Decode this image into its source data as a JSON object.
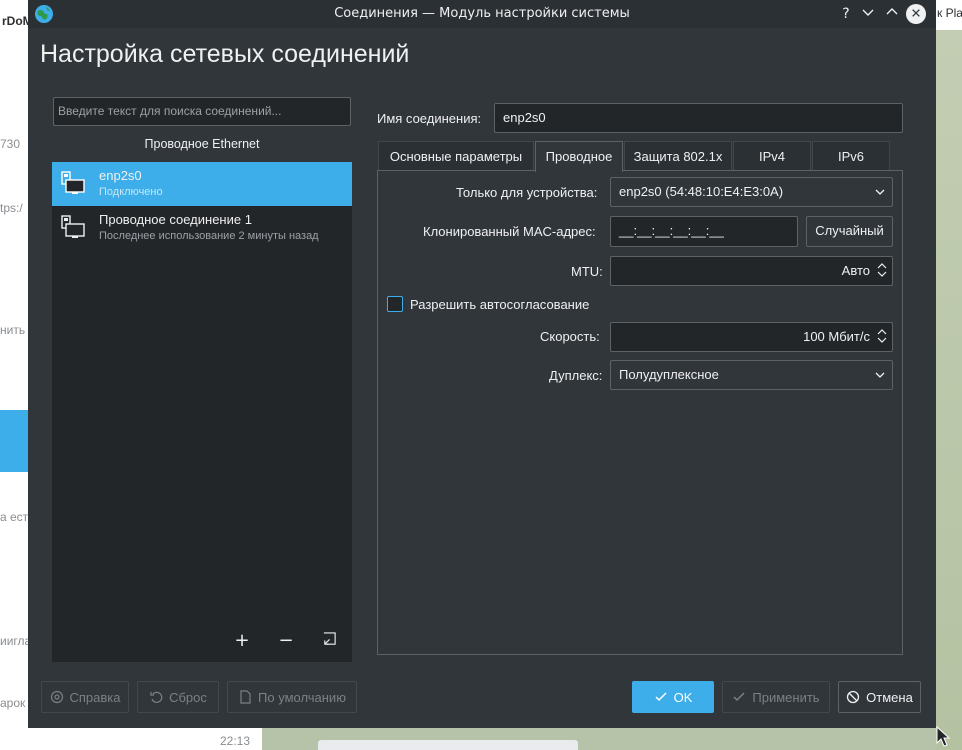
{
  "background": {
    "texts": [
      "rDoM",
      "730",
      "tps:/",
      "нить",
      "а ест",
      "ииглас",
      "арок",
      "22:13",
      "к Pla"
    ]
  },
  "window": {
    "title": "Соединения — Модуль настройки системы",
    "heading": "Настройка сетевых соединений",
    "titlebar_buttons": [
      "?",
      "﹀",
      "︿",
      "✕"
    ]
  },
  "sidebar": {
    "search_placeholder": "Введите текст для поиска соединений...",
    "section_label": "Проводное Ethernet",
    "connections": [
      {
        "name": "enp2s0",
        "status": "Подключено",
        "selected": true
      },
      {
        "name": "Проводное соединение 1",
        "status": "Последнее использование 2 минуты назад",
        "selected": false
      }
    ],
    "tools": {
      "add": "+",
      "remove": "−"
    }
  },
  "editor": {
    "conn_name_label": "Имя соединения:",
    "conn_name_value": "enp2s0",
    "tabs": [
      "Основные параметры",
      "Проводное",
      "Защита 802.1x",
      "IPv4",
      "IPv6"
    ],
    "active_tab": "Проводное",
    "device_label": "Только для устройства:",
    "device_value": "enp2s0 (54:48:10:E4:E3:0A)",
    "mac_label": "Клонированный MAC-адрес:",
    "mac_value": "__:__:__:__:__:__",
    "mac_random": "Случайный",
    "mtu_label": "MTU:",
    "mtu_value": "Авто",
    "autoneg_label": "Разрешить автосогласование",
    "autoneg_checked": false,
    "speed_label": "Скорость:",
    "speed_value": "100 Мбит/с",
    "duplex_label": "Дуплекс:",
    "duplex_value": "Полудуплексное"
  },
  "footer": {
    "help": "Справка",
    "reset": "Сброс",
    "defaults": "По умолчанию",
    "ok": "OK",
    "apply": "Применить",
    "cancel": "Отмена"
  },
  "colors": {
    "accent": "#3daee9",
    "window_bg": "#31363b",
    "field_bg": "#232629",
    "text": "#eff0f1"
  }
}
